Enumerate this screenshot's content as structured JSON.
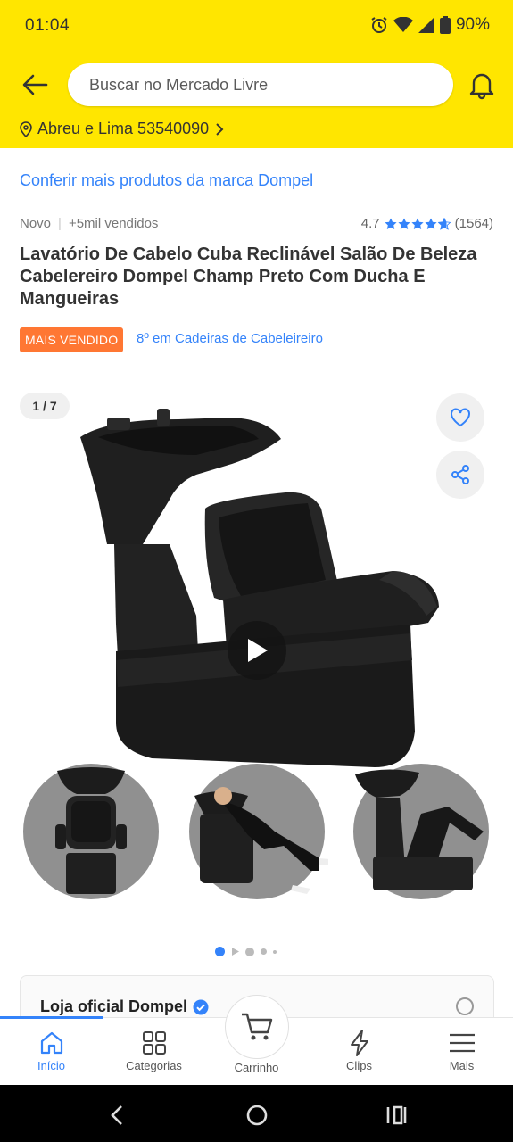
{
  "status_bar": {
    "time": "01:04",
    "battery": "90%",
    "icons": [
      "alarm-icon",
      "wifi-icon",
      "signal-icon",
      "battery-icon"
    ]
  },
  "header": {
    "search_placeholder": "Buscar no Mercado Livre",
    "location": "Abreu e Lima 53540090"
  },
  "product": {
    "brand_link": "Conferir mais produtos da marca Dompel",
    "condition": "Novo",
    "sold": "+5mil vendidos",
    "rating": "4.7",
    "rating_value": 4.7,
    "reviews": "(1564)",
    "title": "Lavatório De Cabelo Cuba Reclinável Salão De Beleza Cabelereiro Dompel Champ Preto Com Ducha E Mangueiras",
    "badge": "MAIS VENDIDO",
    "rank": "8º em Cadeiras de Cabeleireiro"
  },
  "gallery": {
    "counter": "1 / 7"
  },
  "store": {
    "name": "Loja oficial Dompel"
  },
  "bottom_nav": {
    "items": [
      {
        "label": "Início",
        "icon": "home-icon"
      },
      {
        "label": "Categorias",
        "icon": "grid-icon"
      },
      {
        "label": "Carrinho",
        "icon": "cart-icon"
      },
      {
        "label": "Clips",
        "icon": "lightning-icon"
      },
      {
        "label": "Mais",
        "icon": "menu-icon"
      }
    ]
  },
  "colors": {
    "header_yellow": "#FFE600",
    "link_blue": "#3483FA",
    "badge_orange": "#FF7733"
  }
}
